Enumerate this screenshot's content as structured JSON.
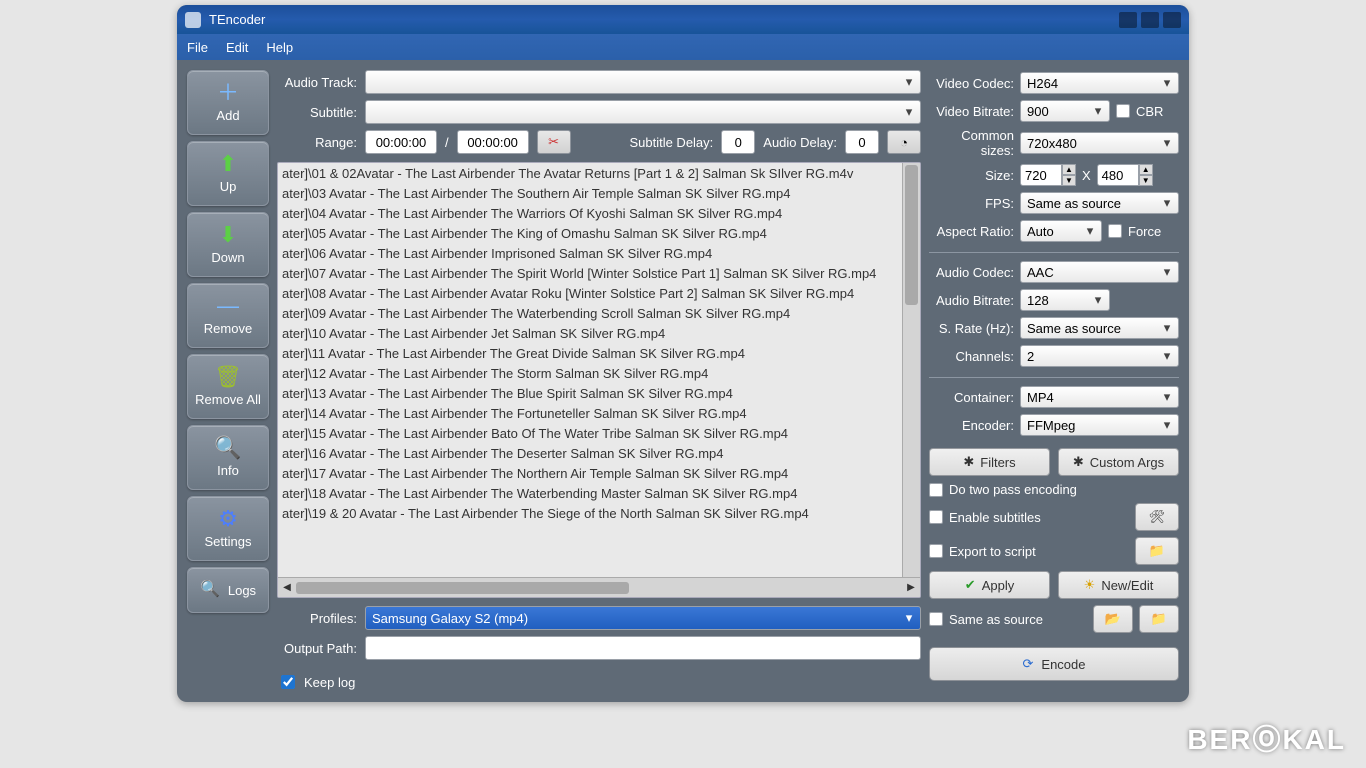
{
  "window": {
    "title": "TEncoder"
  },
  "menu": {
    "file": "File",
    "edit": "Edit",
    "help": "Help"
  },
  "sidebar": {
    "add": "Add",
    "up": "Up",
    "down": "Down",
    "remove": "Remove",
    "remove_all": "Remove All",
    "info": "Info",
    "settings": "Settings",
    "logs": "Logs"
  },
  "top": {
    "audio_track_label": "Audio Track:",
    "subtitle_label": "Subtitle:",
    "range_label": "Range:",
    "range_start": "00:00:00",
    "range_sep": "/",
    "range_end": "00:00:00",
    "subtitle_delay_label": "Subtitle Delay:",
    "subtitle_delay": "0",
    "audio_delay_label": "Audio Delay:",
    "audio_delay": "0"
  },
  "files": [
    "ater]\\01 & 02Avatar - The Last Airbender The Avatar Returns [Part 1 & 2] Salman Sk SIlver RG.m4v",
    "ater]\\03 Avatar - The Last Airbender The Southern Air Temple Salman SK Silver RG.mp4",
    "ater]\\04 Avatar - The Last Airbender The Warriors Of Kyoshi Salman SK Silver RG.mp4",
    "ater]\\05 Avatar - The Last Airbender The King of Omashu Salman SK Silver RG.mp4",
    "ater]\\06 Avatar - The Last Airbender Imprisoned Salman SK Silver RG.mp4",
    "ater]\\07 Avatar - The Last Airbender The Spirit World [Winter Solstice Part 1] Salman SK Silver RG.mp4",
    "ater]\\08 Avatar - The Last Airbender Avatar Roku [Winter Solstice Part 2] Salman SK Silver RG.mp4",
    "ater]\\09 Avatar - The Last Airbender The Waterbending Scroll Salman SK Silver RG.mp4",
    "ater]\\10 Avatar - The Last Airbender Jet Salman SK Silver RG.mp4",
    "ater]\\11 Avatar - The Last Airbender The Great Divide Salman SK Silver RG.mp4",
    "ater]\\12 Avatar - The Last Airbender The Storm Salman SK Silver RG.mp4",
    "ater]\\13 Avatar - The Last Airbender The Blue Spirit Salman SK Silver RG.mp4",
    "ater]\\14 Avatar - The Last Airbender The Fortuneteller Salman SK Silver RG.mp4",
    "ater]\\15 Avatar - The Last Airbender Bato Of The Water Tribe Salman SK Silver RG.mp4",
    "ater]\\16 Avatar - The Last Airbender The Deserter Salman SK Silver RG.mp4",
    "ater]\\17 Avatar - The Last Airbender The Northern Air Temple Salman SK Silver RG.mp4",
    "ater]\\18 Avatar - The Last Airbender The Waterbending Master Salman SK Silver RG.mp4",
    "ater]\\19 & 20 Avatar - The Last Airbender The Siege of the North Salman SK Silver RG.mp4"
  ],
  "bottom": {
    "profiles_label": "Profiles:",
    "profile": "Samsung Galaxy S2 (mp4)",
    "output_label": "Output Path:",
    "output_value": "",
    "keep_log": "Keep log"
  },
  "right": {
    "vcodec_label": "Video Codec:",
    "vcodec": "H264",
    "vbitrate_label": "Video Bitrate:",
    "vbitrate": "900",
    "cbr": "CBR",
    "csizes_label": "Common sizes:",
    "csizes": "720x480",
    "size_label": "Size:",
    "w": "720",
    "x": "X",
    "h": "480",
    "fps_label": "FPS:",
    "fps": "Same as source",
    "ar_label": "Aspect Ratio:",
    "ar": "Auto",
    "force": "Force",
    "acodec_label": "Audio Codec:",
    "acodec": "AAC",
    "abitrate_label": "Audio Bitrate:",
    "abitrate": "128",
    "srate_label": "S. Rate (Hz):",
    "srate": "Same as source",
    "channels_label": "Channels:",
    "channels": "2",
    "container_label": "Container:",
    "container": "MP4",
    "encoder_label": "Encoder:",
    "encoder": "FFMpeg",
    "filters": "Filters",
    "custom_args": "Custom Args",
    "two_pass": "Do two pass encoding",
    "enable_sub": "Enable subtitles",
    "export_script": "Export to script",
    "apply": "Apply",
    "newedit": "New/Edit",
    "same_as_source": "Same as source",
    "encode": "Encode"
  },
  "watermark": "BERⓄKAL"
}
